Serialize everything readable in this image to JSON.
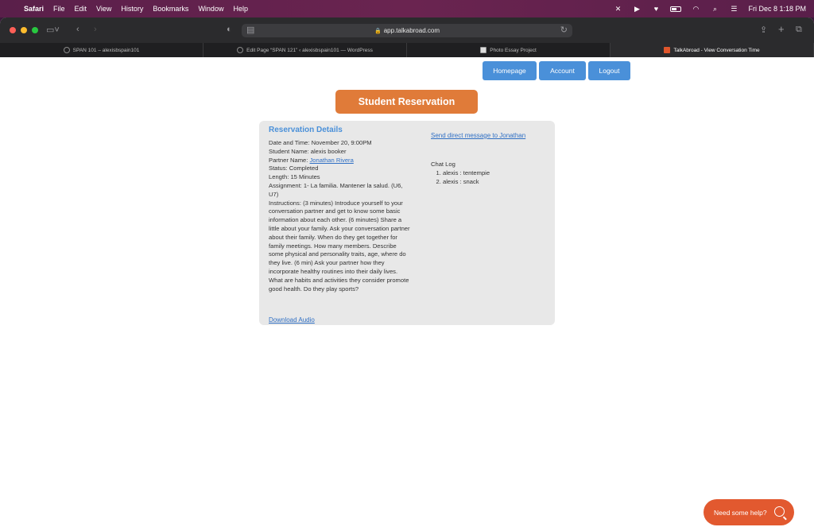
{
  "menubar": {
    "items": [
      "Safari",
      "File",
      "Edit",
      "View",
      "History",
      "Bookmarks",
      "Window",
      "Help"
    ],
    "datetime": "Fri Dec 8  1:18 PM"
  },
  "browser": {
    "url": "app.talkabroad.com",
    "tabs": [
      {
        "label": "SPAN 101 – alexisbspain101",
        "icon": "wordpress-icon"
      },
      {
        "label": "Edit Page “SPAN 121” ‹ alexisbspain101 — WordPress",
        "icon": "wordpress-icon"
      },
      {
        "label": "Photo Essay Project",
        "icon": "photo-essay-icon"
      },
      {
        "label": "TalkAbroad - View Conversation Time",
        "icon": "talkabroad-icon",
        "active": true
      }
    ]
  },
  "nav": {
    "homepage": "Homepage",
    "account": "Account",
    "logout": "Logout"
  },
  "page": {
    "title": "Student Reservation"
  },
  "reservation": {
    "heading": "Reservation Details",
    "datetime_label": "Date and Time: ",
    "datetime_value": "November 20, 9:00PM",
    "student_label": "Student Name: ",
    "student_value": "alexis booker",
    "partner_label": "Partner Name: ",
    "partner_value": "Jonathan Rivera",
    "status_label": "Status: ",
    "status_value": "Completed",
    "length_label": "Length: ",
    "length_value": "15 Minutes",
    "assignment_label": "Assignment: ",
    "assignment_value": "1- La familia. Mantener la salud. (U6, U7)",
    "instructions_label": "Instructions: ",
    "instructions_value": "(3 minutes) Introduce yourself to your conversation partner and get to know some basic information about each other. (6 minutes) Share a little about your family. Ask your conversation partner about their family. When do they get together for family meetings. How many members. Describe some physical and personality traits, age, where do they live. (6 min) Ask your partner how they incorporate healthy routines into their daily lives. What are habits and activities they consider promote good health. Do they play sports?",
    "send_message": "Send direct message to Jonathan",
    "download_audio": "Download Audio"
  },
  "chat_log": {
    "title": "Chat Log",
    "entries": [
      "alexis : tentempie",
      "alexis : snack"
    ]
  },
  "help": {
    "label": "Need some help?"
  }
}
